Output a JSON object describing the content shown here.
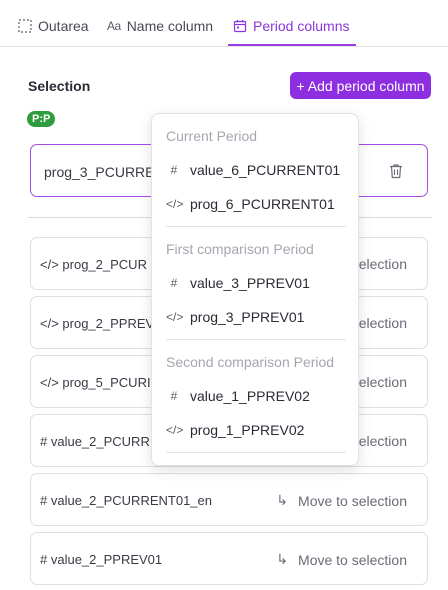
{
  "tabs": [
    {
      "label": "Outarea",
      "icon": "dashed-square-icon"
    },
    {
      "label": "Name column",
      "icon": "text-aa-icon",
      "icon_text": "Aa"
    },
    {
      "label": "Period columns",
      "icon": "calendar-icon",
      "active": true
    }
  ],
  "selection": {
    "title": "Selection",
    "add_button": "+ Add period column",
    "badge": "P:P",
    "selected_item": "prog_3_PCURRE"
  },
  "rows": [
    {
      "label": "</> prog_2_PCUR",
      "action": "selection"
    },
    {
      "label": "</> prog_2_PPREV",
      "action": "selection"
    },
    {
      "label": "</> prog_5_PCURI",
      "action": "selection"
    },
    {
      "label": "# value_2_PCURRI",
      "action": "selection"
    },
    {
      "label": "# value_2_PCURRENT01_en",
      "action": "Move to selection"
    },
    {
      "label": "# value_2_PPREV01",
      "action": "Move to selection"
    }
  ],
  "dropdown": {
    "groups": [
      {
        "heading": "Current Period",
        "items": [
          {
            "symbol": "#",
            "label": "value_6_PCURRENT01"
          },
          {
            "symbol": "</>",
            "label": "prog_6_PCURRENT01"
          }
        ]
      },
      {
        "heading": "First comparison Period",
        "items": [
          {
            "symbol": "#",
            "label": "value_3_PPREV01"
          },
          {
            "symbol": "</>",
            "label": "prog_3_PPREV01"
          }
        ]
      },
      {
        "heading": "Second comparison Period",
        "items": [
          {
            "symbol": "#",
            "label": "value_1_PPREV02"
          },
          {
            "symbol": "</>",
            "label": "prog_1_PPREV02"
          }
        ]
      }
    ]
  },
  "colors": {
    "accent": "#8d2fe0",
    "badge": "#2f9c3d",
    "active_tab": "#8b36d8"
  }
}
